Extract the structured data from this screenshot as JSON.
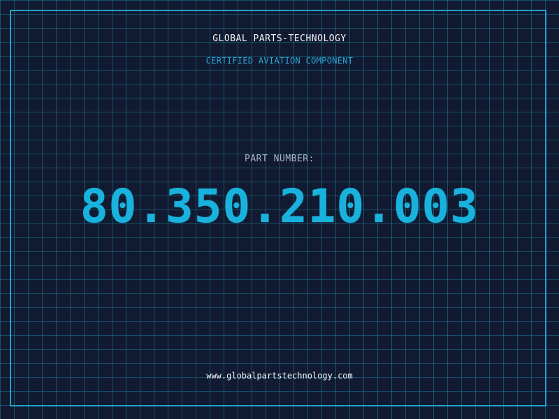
{
  "header": {
    "company": "GLOBAL PARTS-TECHNOLOGY",
    "tagline": "CERTIFIED AVIATION COMPONENT"
  },
  "part": {
    "label": "PART NUMBER:",
    "number": "80.350.210.003"
  },
  "footer": {
    "website": "www.globalpartstechnology.com"
  },
  "colors": {
    "background": "#111a30",
    "grid": "#1e7896",
    "frame": "#1fa3cc",
    "accent": "#19b2dd"
  }
}
